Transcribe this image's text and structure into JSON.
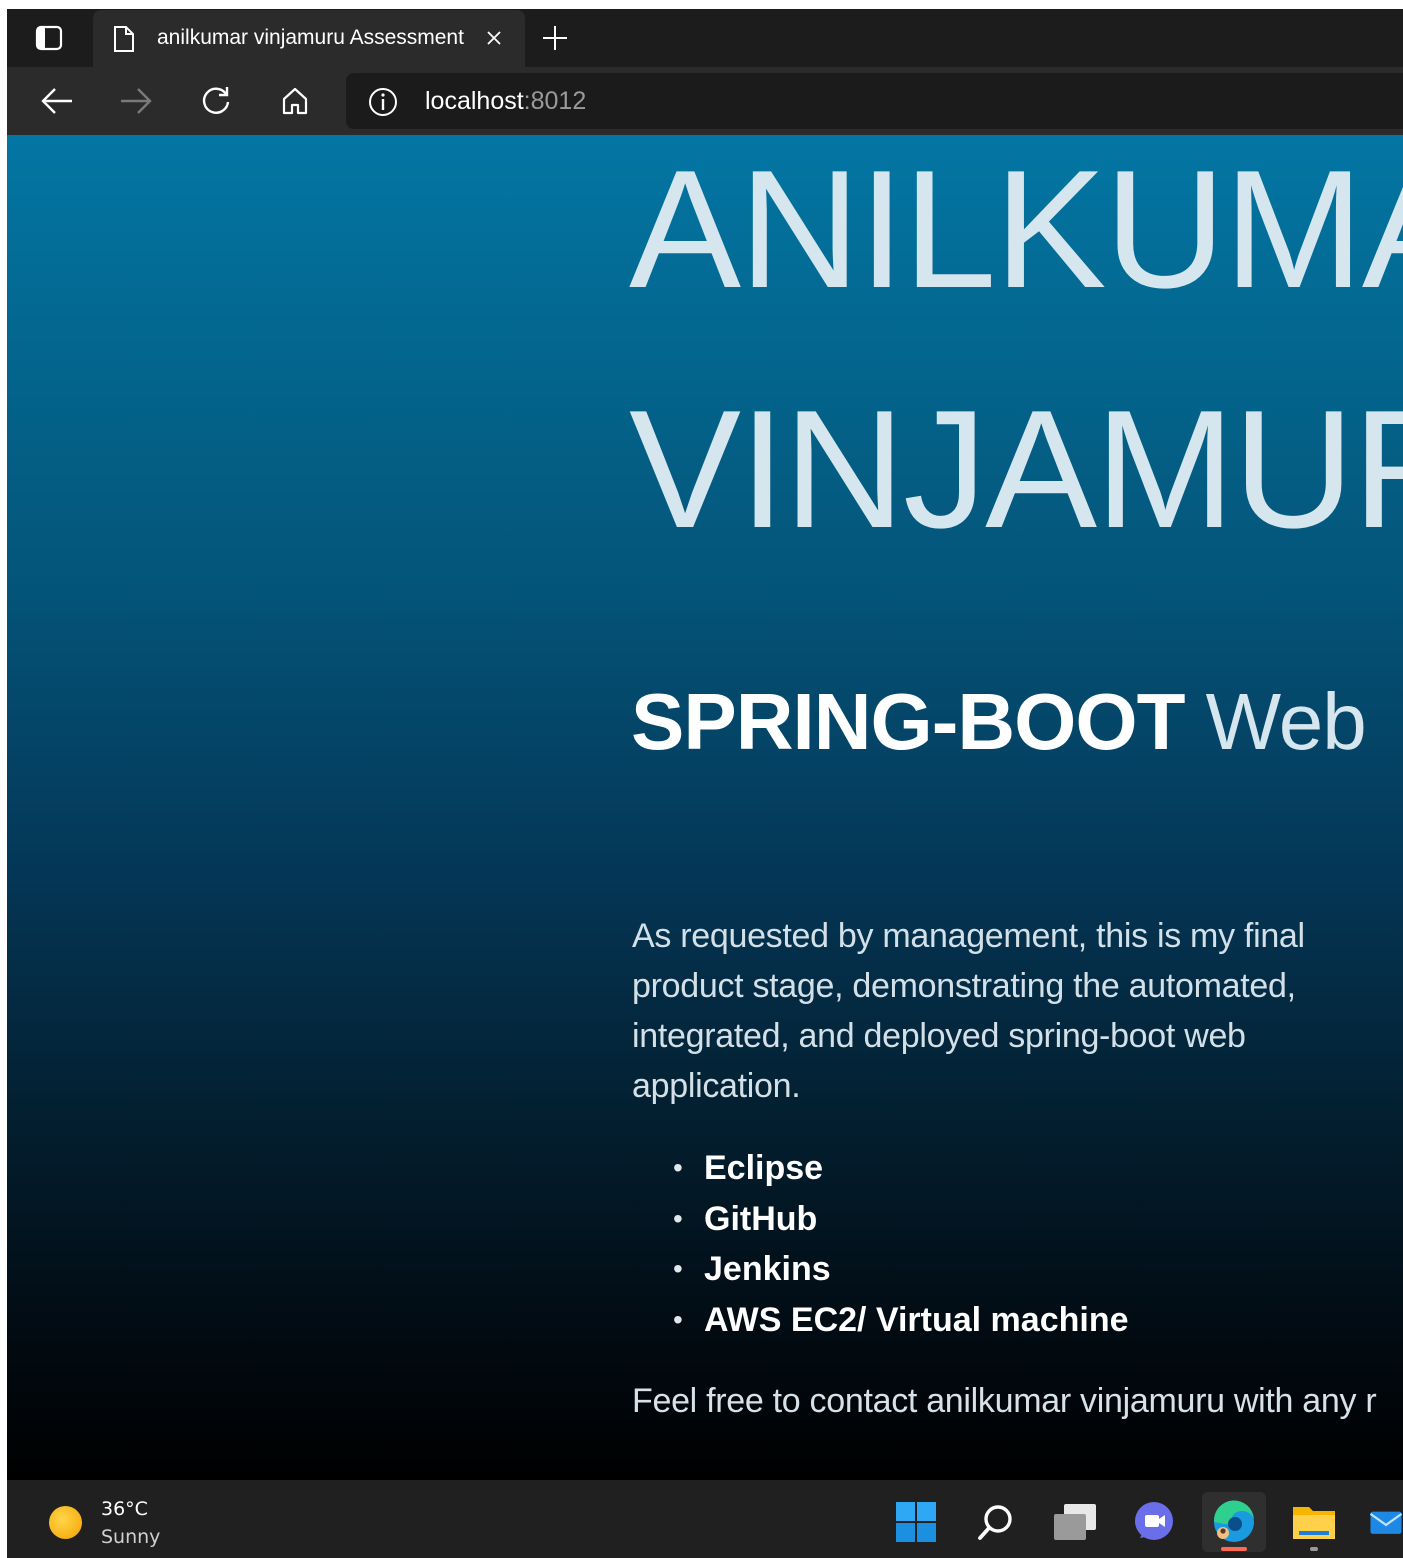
{
  "browser": {
    "tab_title": "anilkumar vinjamuru Assessment",
    "address_host": "localhost",
    "address_port": ":8012"
  },
  "page": {
    "name_line1": "ANILKUMA",
    "name_line2": "VINJAMUR",
    "subtitle_bold": "SPRING-BOOT",
    "subtitle_rest": " Web",
    "paragraph": "As requested by management, this is my final product stage, demonstrating the automated, integrated, and deployed spring-boot web application.",
    "tools": [
      "Eclipse",
      "GitHub",
      "Jenkins",
      "AWS EC2/ Virtual machine"
    ],
    "contact": "Feel free to contact anilkumar vinjamuru with any r"
  },
  "taskbar": {
    "weather_temp": "36°C",
    "weather_condition": "Sunny",
    "icons": [
      "windows-start-icon",
      "search-icon",
      "task-view-icon",
      "teams-chat-icon",
      "edge-browser-icon",
      "file-explorer-icon",
      "mail-icon"
    ]
  },
  "colors": {
    "gradient_top": "#0376a4",
    "gradient_bottom": "#000000",
    "hero_text": "#d6e6ee",
    "browser_chrome": "#2b2b2b"
  }
}
